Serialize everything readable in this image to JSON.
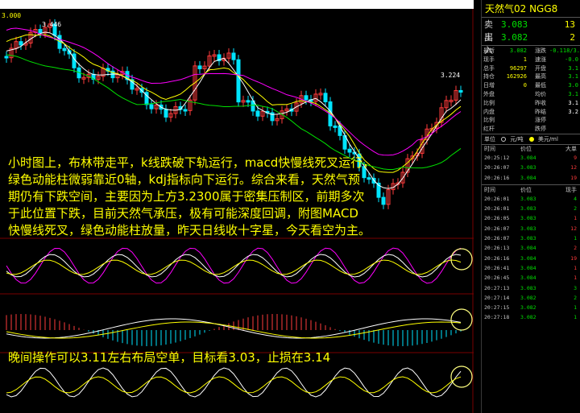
{
  "window": {
    "top_strip_text": ""
  },
  "chart": {
    "price_axis_top": "3.000",
    "high_label": "3.446",
    "recent_high_label": "3.224",
    "colors": {
      "up": "#ff3b3b",
      "down": "#00e5ff",
      "ma_white": "#ffffff",
      "ma_yellow": "#ffff00",
      "ma_magenta": "#ff00ff",
      "ma_green": "#00e000",
      "highlight_circle": "#ffff80"
    }
  },
  "annotations": {
    "analysis": [
      "小时图上，布林带走平，k线跌破下轨运行，macd快慢线死叉运行，",
      "绿色动能柱微弱靠近0轴，kdj指标向下运行。综合来看，天然气预",
      "期仍有下跌空间，主要因为上方3.2300属于密集压制区，前期多次",
      "于此位置下跌，目前天然气承压，极有可能深度回调，附图MACD",
      "快慢线死叉，绿色动能柱放量，昨天日线收十字星，今天看空为主。"
    ],
    "tip": "晚间操作可以3.11左右布局空单，目标看3.03，止损在3.14"
  },
  "panel": {
    "title": "天然气02  NGG8",
    "sell": {
      "label": "卖出",
      "price": "3.083",
      "qty": "13"
    },
    "buy": {
      "label": "买入",
      "price": "3.082",
      "qty": "2"
    },
    "stats": [
      {
        "k1": "最新",
        "v1": "3.082",
        "c1": "green",
        "k2": "涨跌",
        "v2": "-0.118/3.6",
        "c2": "green"
      },
      {
        "k1": "现手",
        "v1": "1",
        "c1": "yellow",
        "k2": "速涨",
        "v2": "-0.0",
        "c2": "green"
      },
      {
        "k1": "总手",
        "v1": "96297",
        "c1": "yellow",
        "k2": "开盘",
        "v2": "3.1",
        "c2": "green"
      },
      {
        "k1": "持仓",
        "v1": "162926",
        "c1": "yellow",
        "k2": "最高",
        "v2": "3.1",
        "c2": "green"
      },
      {
        "k1": "日增",
        "v1": "0",
        "c1": "yellow",
        "k2": "最低",
        "v2": "3.0",
        "c2": "green"
      },
      {
        "k1": "外盘",
        "v1": "",
        "c1": "yellow",
        "k2": "均价",
        "v2": "3.1",
        "c2": "green"
      },
      {
        "k1": "比例",
        "v1": "",
        "c1": "yellow",
        "k2": "昨收",
        "v2": "3.1",
        "c2": "white"
      },
      {
        "k1": "内盘",
        "v1": "",
        "c1": "yellow",
        "k2": "昨结",
        "v2": "3.2",
        "c2": "white"
      },
      {
        "k1": "比例",
        "v1": "",
        "c1": "yellow",
        "k2": "涨停",
        "v2": "",
        "c2": "red"
      },
      {
        "k1": "红杆",
        "v1": "",
        "c1": "yellow",
        "k2": "跌停",
        "v2": "",
        "c2": "green"
      }
    ],
    "unit": {
      "label": "单位",
      "opt1": "元/吨",
      "opt2": "美元/ml"
    },
    "tick1_header": {
      "time": "时间",
      "price": "价位",
      "vol": "大单"
    },
    "tick1": [
      {
        "time": "20:25:12",
        "price": "3.084",
        "vol": "9",
        "vc": "red"
      },
      {
        "time": "20:26:07",
        "price": "3.083",
        "vol": "12",
        "vc": "red"
      },
      {
        "time": "20:26:16",
        "price": "3.084",
        "vol": "19",
        "vc": "red"
      }
    ],
    "tick2_header": {
      "time": "时间",
      "price": "价位",
      "vol": "现手"
    },
    "tick2": [
      {
        "time": "20:26:01",
        "price": "3.083",
        "vol": "4",
        "vc": "green"
      },
      {
        "time": "20:26:01",
        "price": "3.083",
        "vol": "2",
        "vc": "green"
      },
      {
        "time": "20:26:05",
        "price": "3.083",
        "vol": "1",
        "vc": "red"
      },
      {
        "time": "20:26:07",
        "price": "3.083",
        "vol": "12",
        "vc": "red"
      },
      {
        "time": "20:26:07",
        "price": "3.083",
        "vol": "1",
        "vc": "green"
      },
      {
        "time": "20:26:13",
        "price": "3.084",
        "vol": "2",
        "vc": "red"
      },
      {
        "time": "20:26:16",
        "price": "3.084",
        "vol": "19",
        "vc": "red"
      },
      {
        "time": "20:26:41",
        "price": "3.084",
        "vol": "1",
        "vc": "red"
      },
      {
        "time": "20:26:45",
        "price": "3.084",
        "vol": "1",
        "vc": "red"
      },
      {
        "time": "20:27:13",
        "price": "3.083",
        "vol": "3",
        "vc": "green"
      },
      {
        "time": "20:27:14",
        "price": "3.082",
        "vol": "2",
        "vc": "green"
      },
      {
        "time": "20:27:15",
        "price": "3.082",
        "vol": "1",
        "vc": "green"
      },
      {
        "time": "20:27:18",
        "price": "3.082",
        "vol": "1",
        "vc": "green"
      }
    ]
  }
}
